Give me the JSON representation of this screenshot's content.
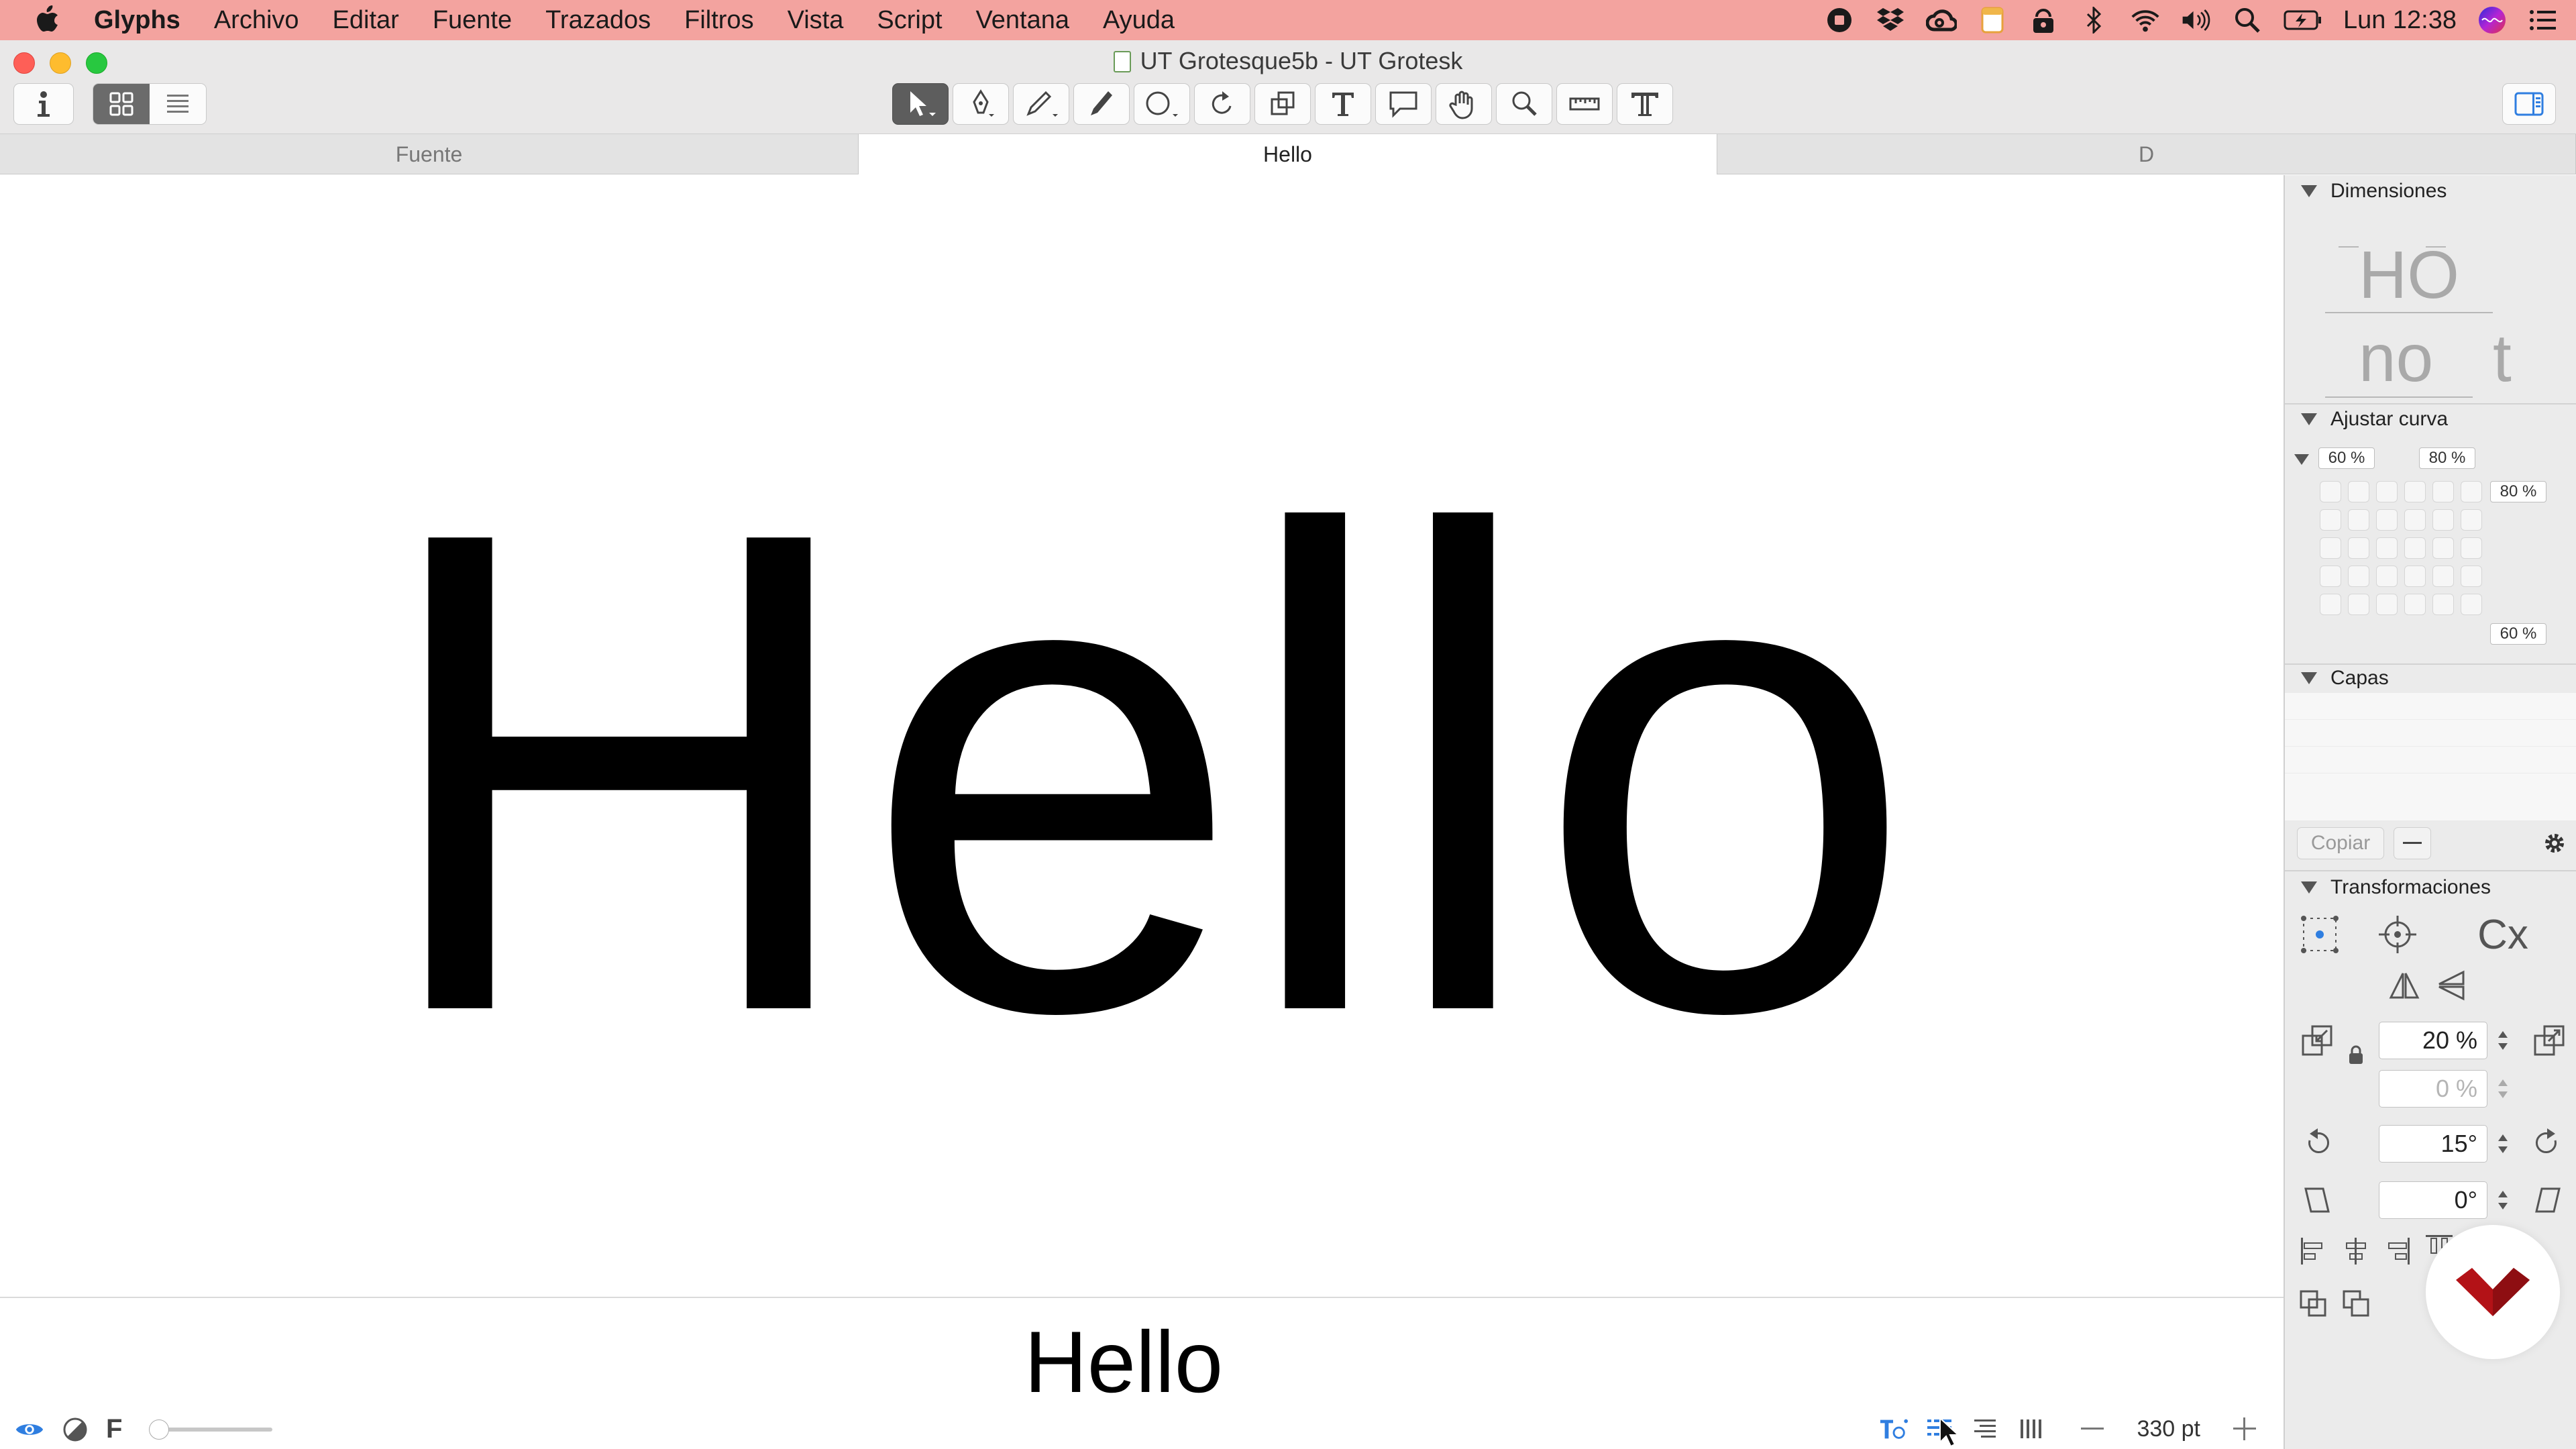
{
  "menubar": {
    "app_name": "Glyphs",
    "items": [
      "Archivo",
      "Editar",
      "Fuente",
      "Trazados",
      "Filtros",
      "Vista",
      "Script",
      "Ventana",
      "Ayuda"
    ],
    "clock": "Lun 12:38",
    "status_icons": [
      "record-stop-icon",
      "dropbox-icon",
      "creative-cloud-icon",
      "notes-icon",
      "user-lock-icon",
      "bluetooth-icon",
      "wifi-icon",
      "volume-icon",
      "search-icon",
      "battery-icon",
      "siri-icon",
      "list-icon"
    ]
  },
  "window": {
    "title": "UT Grotesque5b - UT Grotesk"
  },
  "tabs": [
    {
      "label": "Fuente",
      "active": false
    },
    {
      "label": "Hello",
      "active": true
    },
    {
      "label": "D",
      "active": false
    }
  ],
  "canvas": {
    "text": "Hello"
  },
  "preview": {
    "text": "Hello"
  },
  "bottombar": {
    "f_label": "F",
    "size": "330 pt"
  },
  "panel": {
    "dimensions": {
      "title": "Dimensiones",
      "sample_1": "HO",
      "sample_2": "no",
      "sample_3": "t"
    },
    "curve": {
      "title": "Ajustar curva",
      "top_left": "60 %",
      "top_right": "80 %",
      "right_top": "80 %",
      "right_bottom": "60 %"
    },
    "layers": {
      "title": "Capas",
      "copy_label": "Copiar"
    },
    "transform": {
      "title": "Transformaciones",
      "scale": "20 %",
      "scale_v": "0 %",
      "rotate": "15°",
      "slant": "0°",
      "cx_label": "Cx"
    }
  },
  "colors": {
    "menubar_bg": "#f3a39f",
    "accent_blue": "#2f7ee0",
    "logo_red": "#b31217"
  }
}
